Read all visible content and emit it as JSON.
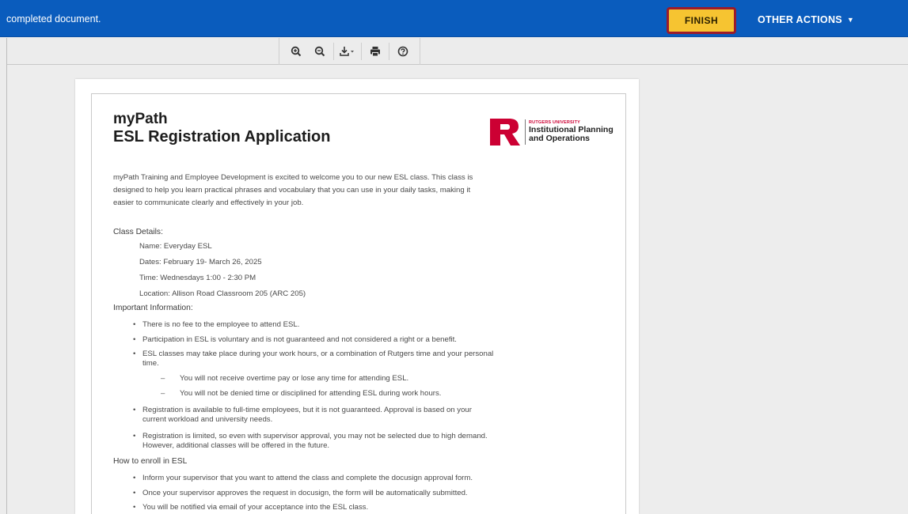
{
  "topbar": {
    "message": "completed document.",
    "finish_label": "FINISH",
    "other_actions_label": "OTHER ACTIONS",
    "finish_color": "#f6c431",
    "bar_color": "#0a5cbd"
  },
  "toolbar": {
    "tools": [
      "zoom-in-icon",
      "zoom-out-icon",
      "download-icon",
      "print-icon",
      "help-icon"
    ]
  },
  "document": {
    "title_line1": "myPath",
    "title_line2": "ESL Registration Application",
    "logo": {
      "small": "RUTGERS UNIVERSITY",
      "line1": "Institutional Planning",
      "line2": "and Operations"
    },
    "intro": [
      "myPath Training and Employee Development is excited to welcome you to our new ESL class. This class is",
      "designed to help you learn practical phrases and vocabulary that you can use in your daily tasks, making it",
      "easier to communicate clearly and effectively in your job."
    ],
    "class_details": {
      "heading": "Class Details:",
      "name": "Name: Everyday ESL",
      "dates": "Dates: February 19- March 26, 2025",
      "time": "Time: Wednesdays 1:00 - 2:30 PM",
      "location": "Location: Allison Road Classroom 205 (ARC 205)"
    },
    "important": {
      "heading": "Important Information:",
      "b1": "There is no fee to the employee to attend ESL.",
      "b2": "Participation in ESL is voluntary and is not guaranteed and not considered a right or a benefit.",
      "b3a": "ESL classes may take place during your work hours, or a combination of Rutgers time and your personal",
      "b3b": "time.",
      "d1": "You will not receive overtime pay or lose any time for attending ESL.",
      "d2": "You will not be denied time or disciplined for attending ESL during work hours.",
      "b4a": "Registration is available to full-time employees, but it is not guaranteed. Approval is based on your",
      "b4b": "current workload and university needs.",
      "b5a": "Registration is limited, so even with supervisor approval, you may not be selected due to high demand.",
      "b5b": "However, additional classes will be offered in the future."
    },
    "enroll": {
      "heading": "How to enroll in ESL",
      "b1": "Inform your supervisor that you want to attend the class and complete the docusign approval form.",
      "b2": "Once your supervisor approves the request in docusign, the form will be automatically submitted.",
      "b3": "You will be notified via email of your acceptance into the ESL class."
    }
  }
}
